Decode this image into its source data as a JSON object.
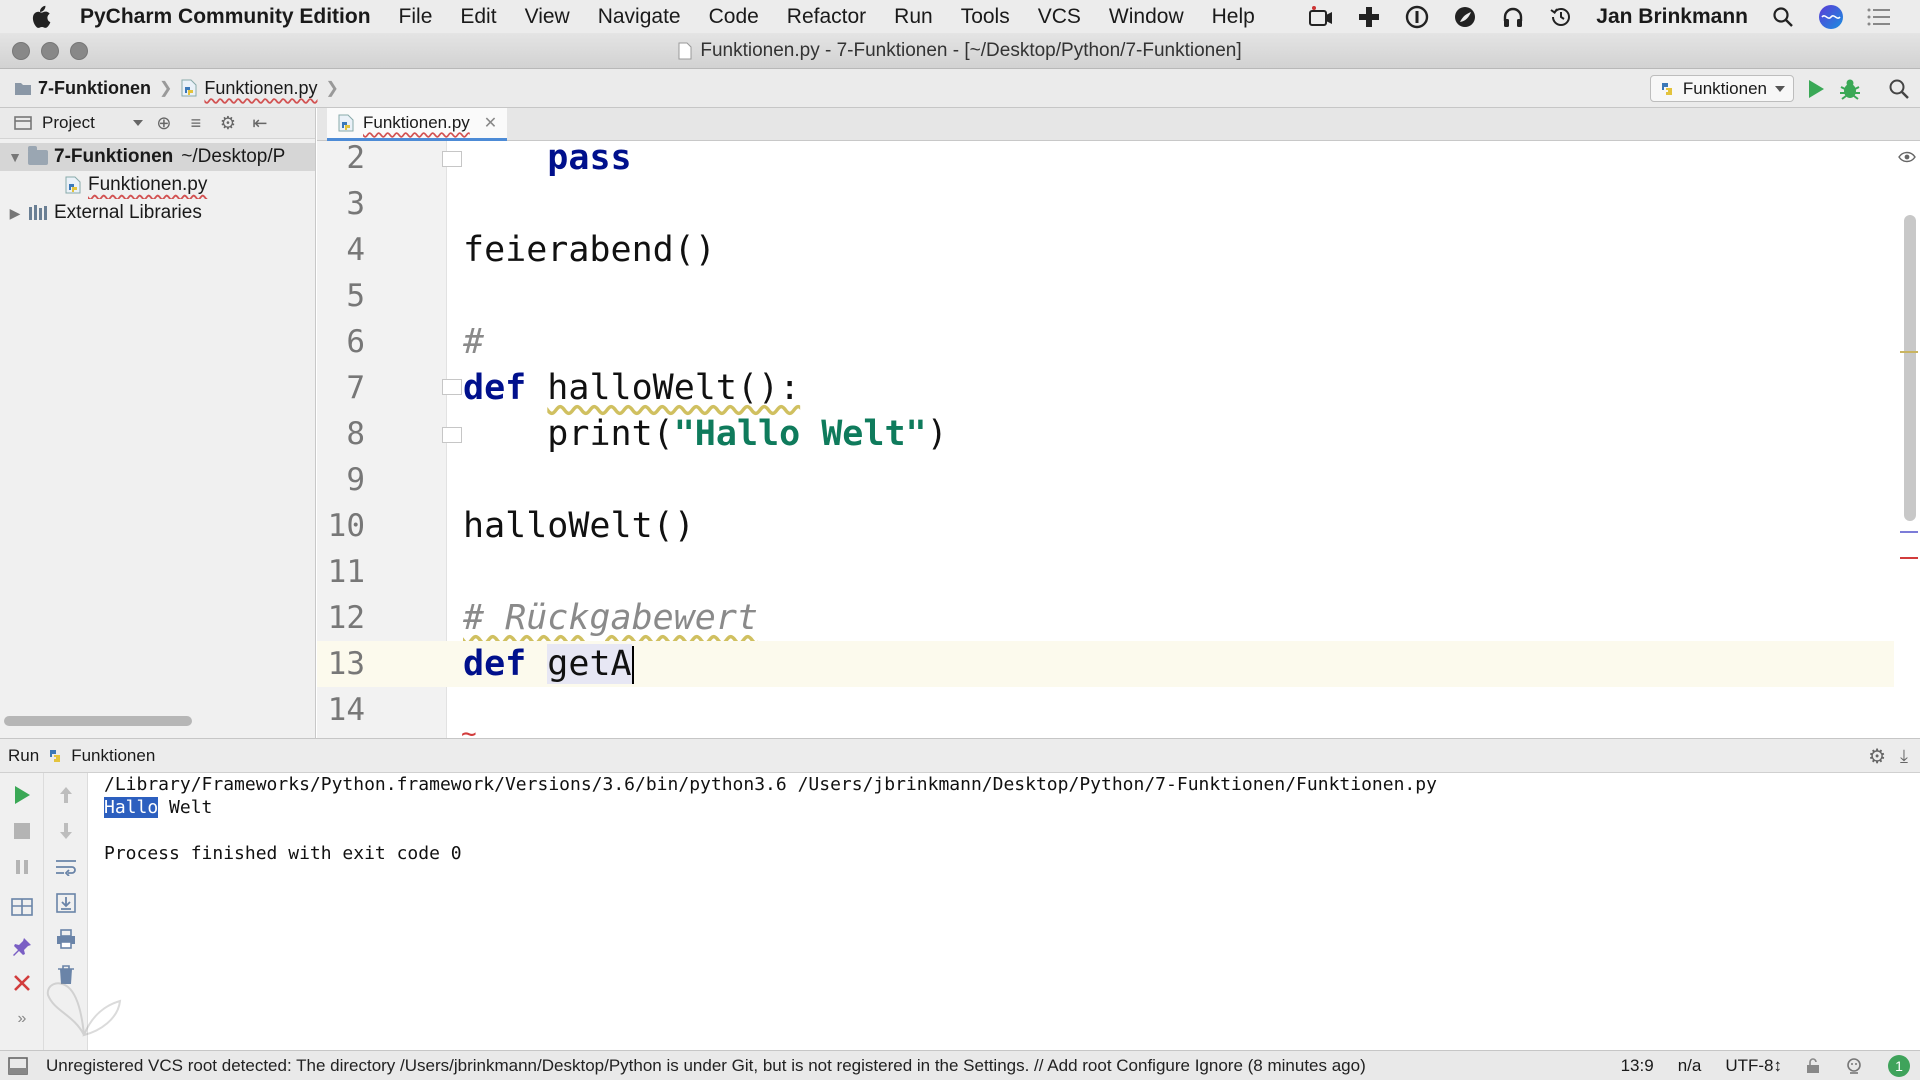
{
  "menubar": {
    "app_name": "PyCharm Community Edition",
    "items": [
      "File",
      "Edit",
      "View",
      "Navigate",
      "Code",
      "Refactor",
      "Run",
      "Tools",
      "VCS",
      "Window",
      "Help"
    ],
    "user": "Jan Brinkmann"
  },
  "window": {
    "title": "Funktionen.py - 7-Funktionen - [~/Desktop/Python/7-Funktionen]"
  },
  "navbar": {
    "crumb_project": "7-Funktionen",
    "crumb_file": "Funktionen.py",
    "run_config": "Funktionen"
  },
  "project": {
    "label": "Project",
    "root_name": "7-Funktionen",
    "root_path": "~/Desktop/P",
    "file": "Funktionen.py",
    "libraries": "External Libraries"
  },
  "editor": {
    "tab": "Funktionen.py",
    "line_numbers": [
      "2",
      "3",
      "4",
      "5",
      "6",
      "7",
      "8",
      "9",
      "10",
      "11",
      "12",
      "13",
      "14"
    ],
    "code": {
      "l2_kw": "pass",
      "l4": "feierabend()",
      "l6": "#",
      "l7_kw": "def",
      "l7_rest": "halloWelt():",
      "l8_func": "print(",
      "l8_str": "\"Hallo Welt\"",
      "l8_end": ")",
      "l10": "halloWelt()",
      "l12": "# Rückgabewert",
      "l13_kw": "def",
      "l13_ident": "getA"
    }
  },
  "run": {
    "label": "Run",
    "config": "Funktionen",
    "command": "/Library/Frameworks/Python.framework/Versions/3.6/bin/python3.6 /Users/jbrinkmann/Desktop/Python/7-Funktionen/Funktionen.py",
    "output_selected": "Hallo",
    "output_rest": " Welt",
    "exit": "Process finished with exit code 0"
  },
  "status": {
    "message": "Unregistered VCS root detected: The directory /Users/jbrinkmann/Desktop/Python is under Git, but is not registered in the Settings. // Add root  Configure  Ignore (8 minutes ago)",
    "position": "13:9",
    "na": "n/a",
    "encoding": "UTF-8",
    "notifications": "1"
  },
  "colors": {
    "run_green": "#3aa856",
    "accent_blue": "#4d8bd6",
    "keyword": "#00108c",
    "string": "#0f7b5c"
  }
}
